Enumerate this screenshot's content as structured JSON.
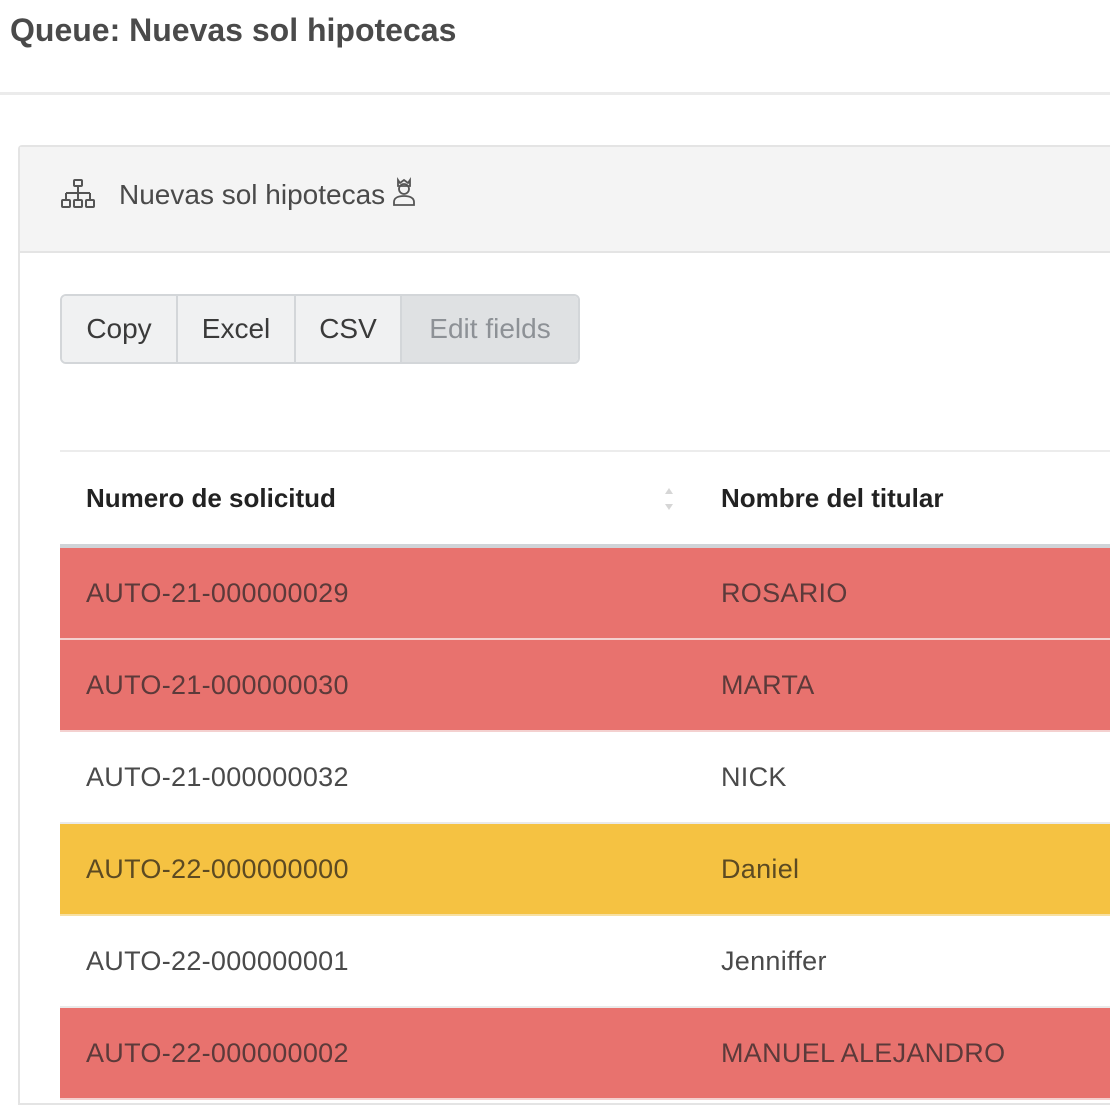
{
  "page": {
    "title": "Queue: Nuevas sol hipotecas"
  },
  "card": {
    "title": "Nuevas sol hipotecas",
    "header_icon": "sitemap-icon",
    "owner_icon": "user-tie-icon"
  },
  "toolbar": {
    "copy_label": "Copy",
    "excel_label": "Excel",
    "csv_label": "CSV",
    "edit_fields_label": "Edit fields"
  },
  "table": {
    "columns": [
      "Numero de solicitud",
      "Nombre del titular"
    ],
    "rows": [
      {
        "numero": "AUTO-21-000000029",
        "nombre": "ROSARIO",
        "status_color": "#e8726e"
      },
      {
        "numero": "AUTO-21-000000030",
        "nombre": "MARTA",
        "status_color": "#e8726e"
      },
      {
        "numero": "AUTO-21-000000032",
        "nombre": "NICK",
        "status_color": "#ffffff"
      },
      {
        "numero": "AUTO-22-000000000",
        "nombre": "Daniel",
        "status_color": "#f5c242"
      },
      {
        "numero": "AUTO-22-000000001",
        "nombre": "Jenniffer",
        "status_color": "#ffffff"
      },
      {
        "numero": "AUTO-22-000000002",
        "nombre": "MANUEL ALEJANDRO",
        "status_color": "#e8726e"
      }
    ]
  }
}
